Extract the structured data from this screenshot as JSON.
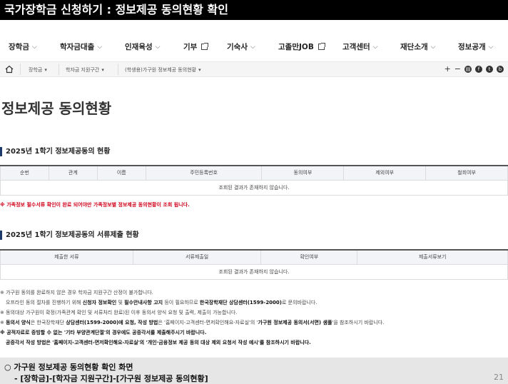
{
  "header": {
    "title": "국가장학금 신청하기 : 정보제공 동의현황 확인"
  },
  "nav": {
    "items": [
      {
        "label": "장학금",
        "icon": "chevron-down-icon"
      },
      {
        "label": "학자금대출",
        "icon": "chevron-down-icon"
      },
      {
        "label": "인재육성",
        "icon": "chevron-down-icon"
      },
      {
        "label": "기부",
        "icon": "external-link-icon"
      },
      {
        "label": "기숙사",
        "icon": "chevron-down-icon"
      },
      {
        "label": "고졸만JOB",
        "icon": "external-link-icon"
      },
      {
        "label": "고객센터",
        "icon": "chevron-down-icon"
      },
      {
        "label": "재단소개",
        "icon": "chevron-down-icon"
      },
      {
        "label": "정보공개",
        "icon": "chevron-down-icon"
      }
    ]
  },
  "breadcrumb": {
    "items": [
      "장학금",
      "학자금 지원구간",
      "(학생용)가구원 정보제공 동의현황"
    ],
    "tools": [
      "+",
      "−",
      "print-icon",
      "facebook-icon",
      "twitter-icon",
      "blog-icon"
    ]
  },
  "page": {
    "title": "정보제공 동의현황"
  },
  "section1": {
    "title": "2025년 1학기 정보제공동의 현황",
    "columns": [
      "순번",
      "관계",
      "이름",
      "주민등록번호",
      "동의여부",
      "제외여부",
      "철회여부"
    ],
    "empty_text": "조회된 결과가 존재하지 않습니다."
  },
  "warning": "※ 가족정보 필수서류 확인이 완료 되어야만 가족정보별 정보제공 동의현황이 조회 됩니다.",
  "section2": {
    "title": "2025년 1학기 정보제공동의 서류제출 현황",
    "columns": [
      "제출한 서류",
      "서류제출일",
      "확인여부",
      "제출서류보기"
    ],
    "empty_text": "조회된 결과가 존재하지 않습니다."
  },
  "notes": {
    "n1": "※ 가구원 동의를 완료하지 않은 경우 학자금 지원구간 산정이 불가합니다.",
    "n2a": "오프라인 동의 절차를 진행하기 위해 ",
    "n2b": "신청자 정보확인",
    "n2c": " 및 ",
    "n2d": "필수안내사항 고지",
    "n2e": " 등이 필요하므로 ",
    "n2f": "한국장학재단 상담센터(1599-2000)",
    "n2g": "로 문의바랍니다.",
    "n3": "※ 동의대상 가구원이 확정(가족관계 확인 및 서류처리 완료)된 이후 동의서 양식 요청 및 출력, 제출이 가능합니다.",
    "n4a": "※ ",
    "n4b": "동의서 양식",
    "n4c": "은 한국장학재단 ",
    "n4d": "상담센터(1599-2000)에 요청, 작성 방법",
    "n4e": "은 '홈페이지-고객센터-면저확인해요-자료실'의 '",
    "n4f": "가구원 정보제공 동의서(서면) 샘플",
    "n4g": "'을 참조하시기 바랍니다.",
    "n5": "※ 공적자료로 증빙할 수 없는 '기타 부양관계단절'의 경우에도 공증각서를 제출해주시기 바랍니다.",
    "n6": "공증각서 작성 방법은 '홈페이지-고객센터-면저확인해요-자료실'의 '개인·금융정보 제공 동의 대상 제외 요청서 작성 예시'를 참조하시기 바랍니다."
  },
  "footer": {
    "line1": "○ 가구원 정보제공 동의현황 확인 화면",
    "line2": "- [장학금]-[학자금 지원구간]-[가구원 정보제공 동의현황]",
    "page_no": "21"
  }
}
